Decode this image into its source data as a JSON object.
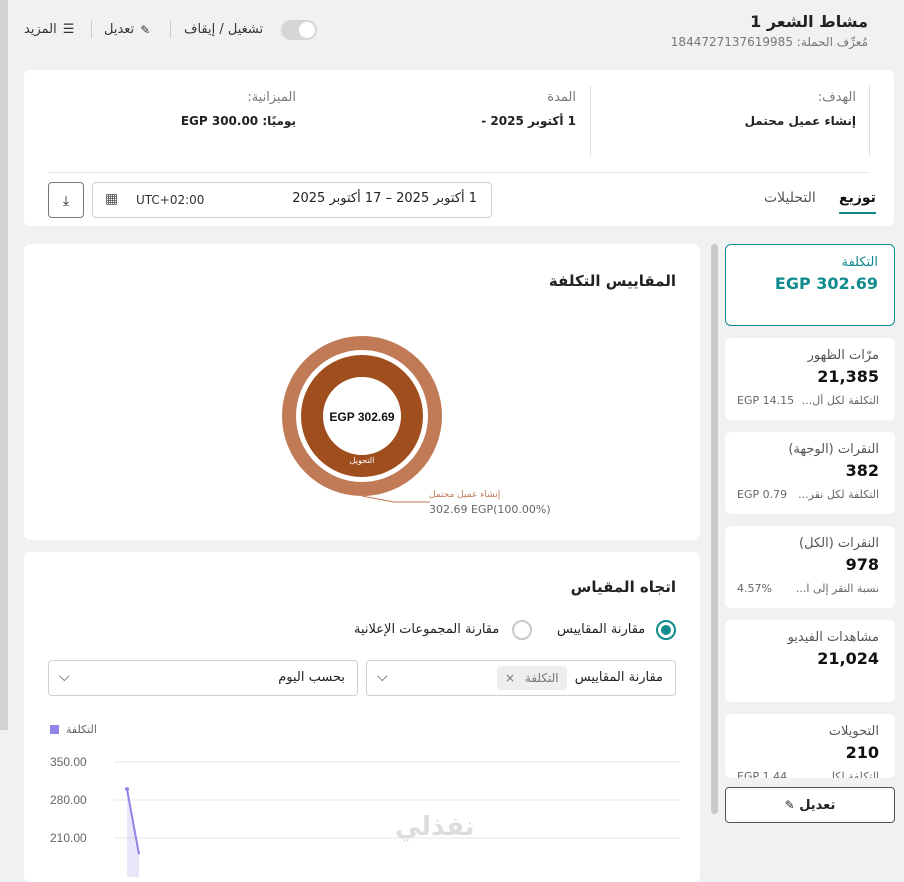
{
  "header": {
    "campaign_title": "مشاط الشعر 1",
    "campaign_id_label": "مُعرِّف الحملة:",
    "campaign_id": "1844727137619985",
    "toggle_label": "تشغيل / إيقاف",
    "edit_label": "تعديل",
    "more_label": "المزيد"
  },
  "summary": {
    "goal_label": "الهدف:",
    "goal_value": "إنشاء عميل محتمل",
    "duration_label": "المدة",
    "duration_value": "1 أكتوبر 2025 -",
    "budget_label": "الميزانية:",
    "budget_value": "يوميًا: EGP 300.00"
  },
  "tabs": [
    {
      "label": "توزيع",
      "active": true
    },
    {
      "label": "التحليلات",
      "active": false
    }
  ],
  "date_range": {
    "range": "1 أكتوبر 2025 – 17 أكتوبر 2025",
    "timezone": "UTC+02:00"
  },
  "metrics": [
    {
      "title": "التكلفة",
      "value": "EGP 302.69",
      "selected": true
    },
    {
      "title": "مرّات الظهور",
      "value": "21,385",
      "sub_label": "التكلفة لكل أل...",
      "sub_value": "EGP 14.15"
    },
    {
      "title": "النقرات (الوجهة)",
      "value": "382",
      "sub_label": "التكلفة لكل نقر...",
      "sub_value": "EGP 0.79"
    },
    {
      "title": "النقرات (الكل)",
      "value": "978",
      "sub_label": "نسبة النقر إلى ا...",
      "sub_value": "4.57%"
    },
    {
      "title": "مشاهدات الفيديو",
      "value": "21,024"
    },
    {
      "title": "التحويلات",
      "value": "210",
      "sub_label": "التكلفة لكل...",
      "sub_value": "EGP 1.44"
    }
  ],
  "edit_button_label": "تعديل",
  "cost_metrics": {
    "title": "المقاييس التكلفة",
    "center_value": "EGP 302.69",
    "inner_label": "التحويل",
    "callout_name": "إنشاء عميل محتمل",
    "callout_value": "302.69 EGP(100.00%)"
  },
  "trend": {
    "title": "اتجاه المقياس",
    "radio_compare_metrics": "مقارنة المقاييس",
    "radio_compare_adsets": "مقارنة المجموعات الإعلانية",
    "metric_select_label": "مقارنة المقاييس",
    "metric_chip": "التكلفة",
    "granularity": "بحسب اليوم"
  },
  "colors": {
    "accent": "#0f8b8d",
    "donut_outer": "#c07a56",
    "donut_inner": "#a14e1e",
    "series": "#8f84e8"
  },
  "chart_data": {
    "type": "line",
    "legend": [
      "التكلفة"
    ],
    "y_ticks": [
      "350.00",
      "280.00",
      "210.00"
    ],
    "series": [
      {
        "name": "التكلفة",
        "values": [
          300,
          180
        ]
      }
    ]
  }
}
